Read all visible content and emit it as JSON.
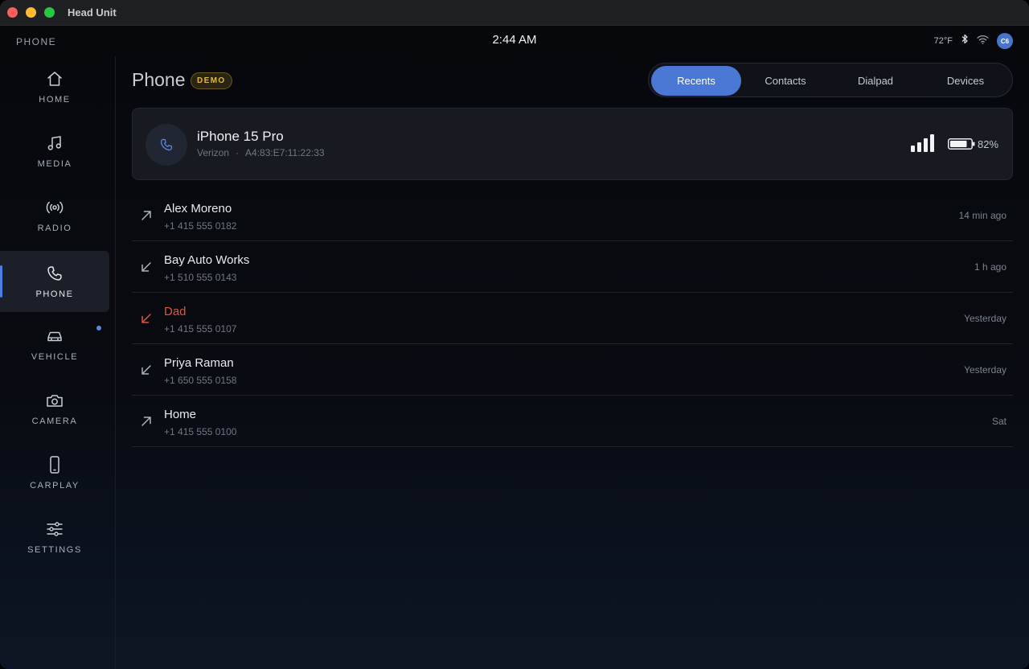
{
  "window": {
    "title": "Head Unit"
  },
  "status": {
    "section": "PHONE",
    "time": "2:44 AM",
    "temperature": "72°F",
    "avatar_initials": "C6",
    "avatar_color": "#4a74c9"
  },
  "sidebar": {
    "items": [
      {
        "label": "HOME",
        "icon": "home-icon"
      },
      {
        "label": "MEDIA",
        "icon": "music-note-icon"
      },
      {
        "label": "RADIO",
        "icon": "radio-broadcast-icon"
      },
      {
        "label": "PHONE",
        "icon": "phone-icon",
        "active": true
      },
      {
        "label": "VEHICLE",
        "icon": "car-icon",
        "notification_dot": true
      },
      {
        "label": "CAMERA",
        "icon": "camera-icon"
      },
      {
        "label": "CARPLAY",
        "icon": "smartphone-icon"
      },
      {
        "label": "SETTINGS",
        "icon": "sliders-icon"
      }
    ]
  },
  "header": {
    "title": "Phone",
    "badge": "DEMO"
  },
  "tabs": [
    {
      "label": "Recents",
      "active": true
    },
    {
      "label": "Contacts"
    },
    {
      "label": "Dialpad"
    },
    {
      "label": "Devices"
    }
  ],
  "device": {
    "name": "iPhone 15 Pro",
    "carrier": "Verizon",
    "separator": "·",
    "mac": "A4:83:E7:11:22:33",
    "signal_bars": 4,
    "battery_level": 0.82,
    "battery_label": "82%"
  },
  "recents": [
    {
      "name": "Alex Moreno",
      "number": "+1 415 555 0182",
      "time": "14 min ago",
      "direction": "outgoing",
      "icon": "outgoing-call-icon"
    },
    {
      "name": "Bay Auto Works",
      "number": "+1 510 555 0143",
      "time": "1 h ago",
      "direction": "incoming",
      "icon": "incoming-call-icon"
    },
    {
      "name": "Dad",
      "number": "+1 415 555 0107",
      "time": "Yesterday",
      "direction": "missed",
      "icon": "missed-call-icon"
    },
    {
      "name": "Priya Raman",
      "number": "+1 650 555 0158",
      "time": "Yesterday",
      "direction": "incoming",
      "icon": "incoming-call-icon"
    },
    {
      "name": "Home",
      "number": "+1 415 555 0100",
      "time": "Sat",
      "direction": "outgoing",
      "icon": "outgoing-call-icon"
    }
  ],
  "colors": {
    "accent": "#4a78d4",
    "missed": "#e2533f",
    "badge": "#e0b94a"
  }
}
